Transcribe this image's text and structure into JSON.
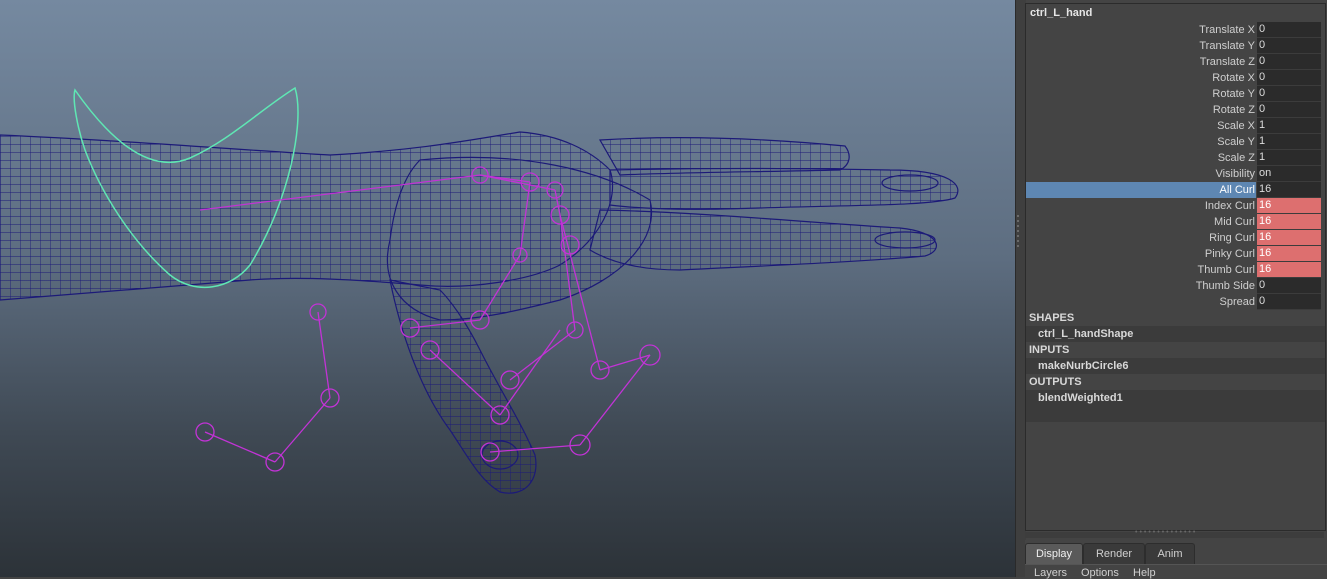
{
  "node_name": "ctrl_L_hand",
  "attributes": [
    {
      "label": "Translate X",
      "value": "0",
      "keyed": false,
      "selected": false
    },
    {
      "label": "Translate Y",
      "value": "0",
      "keyed": false,
      "selected": false
    },
    {
      "label": "Translate Z",
      "value": "0",
      "keyed": false,
      "selected": false
    },
    {
      "label": "Rotate X",
      "value": "0",
      "keyed": false,
      "selected": false
    },
    {
      "label": "Rotate Y",
      "value": "0",
      "keyed": false,
      "selected": false
    },
    {
      "label": "Rotate Z",
      "value": "0",
      "keyed": false,
      "selected": false
    },
    {
      "label": "Scale X",
      "value": "1",
      "keyed": false,
      "selected": false
    },
    {
      "label": "Scale Y",
      "value": "1",
      "keyed": false,
      "selected": false
    },
    {
      "label": "Scale Z",
      "value": "1",
      "keyed": false,
      "selected": false
    },
    {
      "label": "Visibility",
      "value": "on",
      "keyed": false,
      "selected": false
    },
    {
      "label": "All Curl",
      "value": "16",
      "keyed": false,
      "selected": true
    },
    {
      "label": "Index Curl",
      "value": "16",
      "keyed": true,
      "selected": false
    },
    {
      "label": "Mid Curl",
      "value": "16",
      "keyed": true,
      "selected": false
    },
    {
      "label": "Ring Curl",
      "value": "16",
      "keyed": true,
      "selected": false
    },
    {
      "label": "Pinky Curl",
      "value": "16",
      "keyed": true,
      "selected": false
    },
    {
      "label": "Thumb Curl",
      "value": "16",
      "keyed": true,
      "selected": false
    },
    {
      "label": "Thumb Side",
      "value": "0",
      "keyed": false,
      "selected": false
    },
    {
      "label": "Spread",
      "value": "0",
      "keyed": false,
      "selected": false
    }
  ],
  "sections": {
    "shapes": {
      "label": "SHAPES",
      "node": "ctrl_L_handShape"
    },
    "inputs": {
      "label": "INPUTS",
      "node": "makeNurbCircle6"
    },
    "outputs": {
      "label": "OUTPUTS",
      "node": "blendWeighted1"
    }
  },
  "layer_tabs": [
    "Display",
    "Render",
    "Anim"
  ],
  "active_tab": "Display",
  "layer_menu": [
    "Layers",
    "Options",
    "Help"
  ],
  "colors": {
    "selected_row": "#5e87b3",
    "keyed_value": "#dd6f6f",
    "mesh_wire": "#1c1a78",
    "joints": "#c233d6",
    "control_curve": "#5fe7b4"
  }
}
